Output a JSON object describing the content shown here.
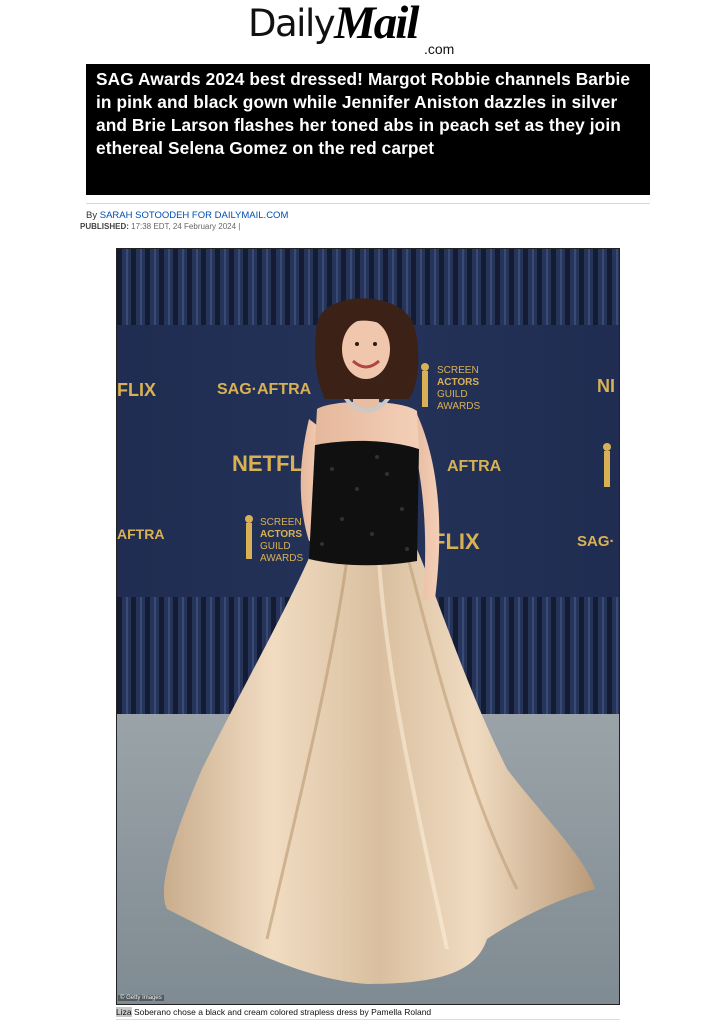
{
  "masthead": {
    "logo_daily": "Daily",
    "logo_mail": "Mail",
    "logo_com": ".com"
  },
  "article": {
    "headline": "SAG Awards 2024 best dressed! Margot Robbie channels Barbie in pink and black gown while Jennifer Aniston dazzles in silver and Brie Larson flashes her toned abs in peach set as they join ethereal Selena Gomez on the red carpet",
    "byline_prefix": "By ",
    "byline_author": "SARAH SOTOODEH FOR DAILYMAIL.COM",
    "published_label": "PUBLISHED:",
    "published_value": " 17:38 EDT, 24 February 2024 |"
  },
  "photo": {
    "credit": "© Getty Images",
    "caption_highlight": "Liza",
    "caption_rest": " Soberano chose a black and cream colored strapless dress by Pamella Roland",
    "backdrop_texts": {
      "sag_aftra": "SAG·AFTRA",
      "screen": "SCREEN",
      "actors": "ACTORS",
      "guild": "GUILD",
      "awards": "AWARDS",
      "netflix": "NETFLIX",
      "aftra": "AFTRA",
      "sag_cut": "SAG·",
      "flix_cut": "FLIX",
      "ni_cut": "NI"
    }
  },
  "colors": {
    "headline_bg": "#000000",
    "author_link": "#004db3",
    "backdrop_navy": "#1f2d4e",
    "backdrop_gold": "#d9b155",
    "gown_cream": "#e6cfb4",
    "carpet_gray": "#8f9aa1"
  }
}
